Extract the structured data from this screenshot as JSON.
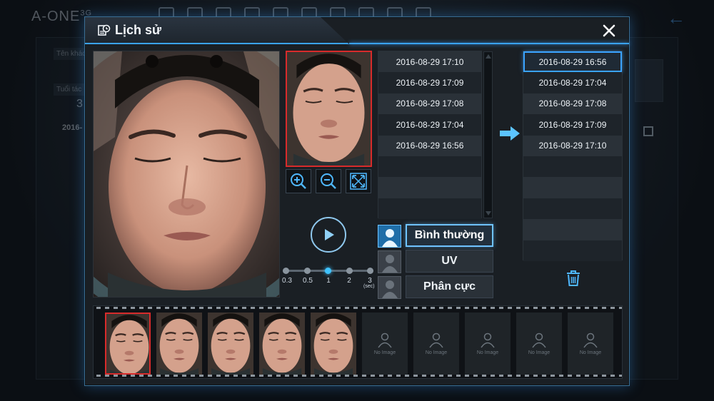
{
  "background_app": {
    "logo": "A-ONE",
    "logo_suffix": "3G",
    "back_icon": "back-arrow-icon",
    "customer_name_label": "Tên khách",
    "age_label": "Tuổi tác",
    "age_value": "3",
    "date_partial": "2016-"
  },
  "dialog": {
    "title": "Lịch sử",
    "title_icon": "history-icon",
    "close_icon": "close-icon"
  },
  "zoom_controls": [
    {
      "icon": "zoom-in-icon"
    },
    {
      "icon": "zoom-out-icon"
    },
    {
      "icon": "fullscreen-icon"
    }
  ],
  "playback": {
    "play_icon": "play-icon",
    "speeds": [
      "0.3",
      "0.5",
      "1",
      "2",
      "3"
    ],
    "selected_speed": "1",
    "unit": "(sec)"
  },
  "history_list": {
    "items": [
      "2016-08-29 17:10",
      "2016-08-29 17:09",
      "2016-08-29 17:08",
      "2016-08-29 17:04",
      "2016-08-29 16:56"
    ],
    "total_rows": 8
  },
  "modes": [
    {
      "label": "Bình thường",
      "active": true
    },
    {
      "label": "UV",
      "active": false
    },
    {
      "label": "Phân cực",
      "active": false
    }
  ],
  "selected_list": {
    "items": [
      "2016-08-29 16:56",
      "2016-08-29 17:04",
      "2016-08-29 17:08",
      "2016-08-29 17:09",
      "2016-08-29 17:10"
    ],
    "selected_index": 0,
    "total_rows": 10
  },
  "filmstrip": {
    "photo_frames": 5,
    "empty_frames": 5,
    "empty_label": "No Image",
    "selected_index": 0
  },
  "colors": {
    "accent": "#3aa3ff",
    "selected_frame": "#d82b2b",
    "panel_bg": "#1a1f24"
  }
}
